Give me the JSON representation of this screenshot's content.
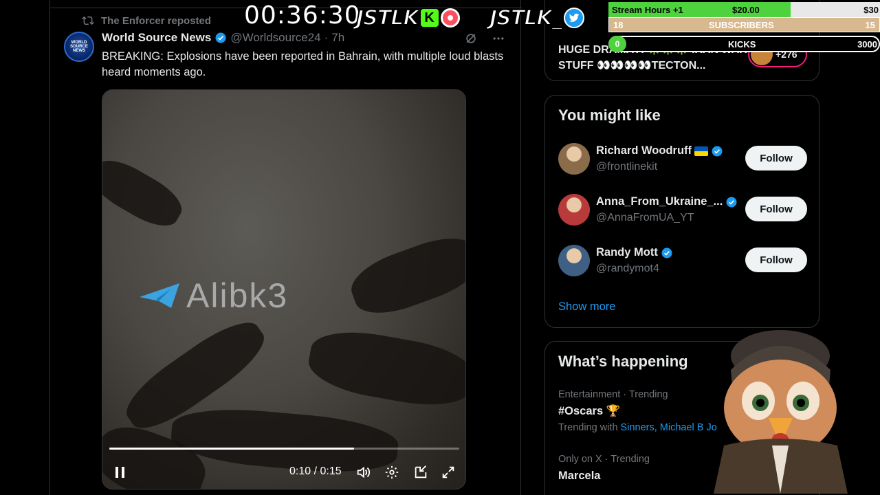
{
  "tweet": {
    "repost_label": "The Enforcer reposted",
    "avatar_text": "WORLD SOURCE NEWS",
    "author_name": "World Source News",
    "author_handle": "@Worldsource24",
    "separator": "·",
    "time": "7h",
    "text": "BREAKING: Explosions have been reported in Bahrain, with multiple loud blasts heard moments ago."
  },
  "video": {
    "watermark": "Alibk3",
    "time_display": "0:10 / 0:15",
    "progress_fraction": 0.7
  },
  "live_card": {
    "title": "HUGE DRAMA?! ✳️✳️✳️ IRAN WAR STUFF 👀👀👀👀TECTON...",
    "listeners": "+276"
  },
  "you_might_like": {
    "title": "You might like",
    "users": [
      {
        "name": "Richard Woodruff",
        "handle": "@frontlinekit",
        "follow": "Follow",
        "avatar_color": "#8a6b4a"
      },
      {
        "name": "Anna_From_Ukraine_...",
        "handle": "@AnnaFromUA_YT",
        "follow": "Follow",
        "avatar_color": "#b83a3a"
      },
      {
        "name": "Randy Mott",
        "handle": "@randymot4",
        "follow": "Follow",
        "avatar_color": "#3f5f85"
      }
    ],
    "show_more": "Show more"
  },
  "whats_happening": {
    "title": "What’s happening",
    "trends": [
      {
        "meta": "Entertainment · Trending",
        "name": "#Oscars 🏆",
        "with_label": "Trending with",
        "with_links": "Sinners, Michael B Jo"
      },
      {
        "meta": "Only on X · Trending",
        "name": "Marcela"
      }
    ]
  },
  "stream_overlay": {
    "timer": "00:36:30",
    "brand1": "JSTLK",
    "kick_letter": "K",
    "brand2": "JSTLK_",
    "goal1_label": "Stream Hours +1",
    "goal1_amount": "$20.00",
    "goal1_target": "$30",
    "goal1_fraction": 0.67,
    "goal2_current": "18",
    "goal2_label": "SUBSCRIBERS",
    "goal2_target": "15",
    "goal3_current": "0",
    "goal3_label": "KICKS",
    "goal3_target": "3000"
  },
  "colors": {
    "accent": "#1d9bf0",
    "text": "#e7e9ea",
    "muted": "#71767b",
    "border": "#2f3336",
    "live": "#f91880",
    "kick_green": "#53fc18"
  }
}
